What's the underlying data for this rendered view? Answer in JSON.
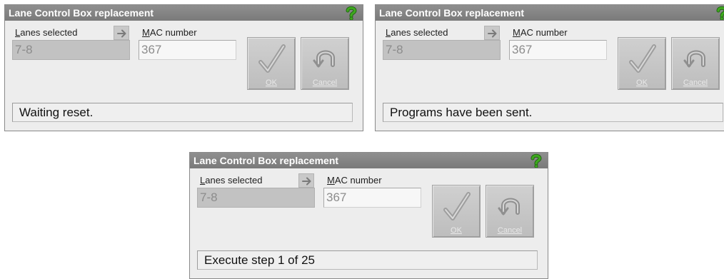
{
  "dialogs": [
    {
      "title": "Lane Control Box replacement",
      "lanes_label": "Lanes selected",
      "mac_label": "MAC number",
      "lanes_value": "7-8",
      "mac_value": "367",
      "ok_label": "OK",
      "cancel_label": "Cancel",
      "status": "Waiting reset."
    },
    {
      "title": "Lane Control Box replacement",
      "lanes_label": "Lanes selected",
      "mac_label": "MAC number",
      "lanes_value": "7-8",
      "mac_value": "367",
      "ok_label": "OK",
      "cancel_label": "Cancel",
      "status": "Programs have been sent."
    },
    {
      "title": "Lane Control Box replacement",
      "lanes_label": "Lanes selected",
      "mac_label": "MAC number",
      "lanes_value": "7-8",
      "mac_value": "367",
      "ok_label": "OK",
      "cancel_label": "Cancel",
      "status": "Execute step 1 of 25"
    }
  ],
  "icons": {
    "help": "help-question-icon",
    "arrow": "arrow-right-icon",
    "ok": "checkmark-icon",
    "cancel": "undo-arc-icon"
  },
  "colors": {
    "titlebar": "#808080",
    "help_icon": "#3ea91e",
    "dialog_bg": "#ededed"
  }
}
